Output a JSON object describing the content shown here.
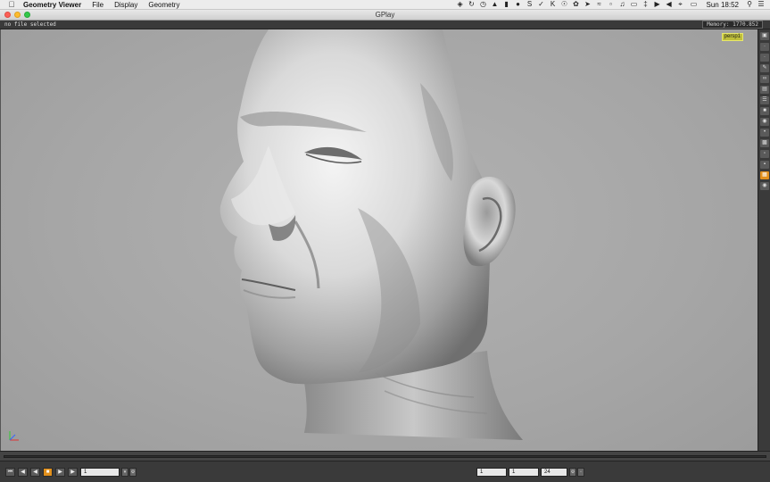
{
  "menubar": {
    "apple_icon": "apple-logo-icon",
    "items": [
      "Geometry Viewer",
      "File",
      "Display",
      "Geometry"
    ],
    "clock": "Sun 18:52",
    "tray_icons": [
      "dropbox-icon",
      "sync-icon",
      "clock-icon",
      "drive-icon",
      "bookmark-icon",
      "evernote-icon",
      "skype-icon",
      "bolt-icon",
      "kiwi-icon",
      "alarm-icon",
      "paw-icon",
      "rocket-icon",
      "wave-icon",
      "clip-icon",
      "note-icon",
      "airplay-icon",
      "bluetooth-icon",
      "play-icon",
      "volume-icon",
      "wifi-icon",
      "battery-icon",
      "search-icon",
      "list-icon"
    ]
  },
  "window": {
    "title": "GPlay"
  },
  "status": {
    "message": "no file selected",
    "memory": "Memory: 1770.852"
  },
  "viewport": {
    "camera": "persp1",
    "model": "3D scanned head mesh"
  },
  "toolbar": {
    "buttons": [
      "viewport-icon",
      "dot-icon",
      "dot-icon",
      "pen-icon",
      "link-icon",
      "display-icon",
      "layers-icon",
      "lock-icon",
      "sphere-icon",
      "brush-icon",
      "print-icon",
      "chat-icon",
      "save-icon",
      "grid-icon",
      "camera-icon"
    ]
  },
  "playback": {
    "buttons": [
      "first-frame-icon",
      "prev-key-icon",
      "step-back-icon",
      "stop-play-icon",
      "step-forward-icon",
      "last-frame-icon"
    ],
    "current_frame": "1",
    "range_start": "1",
    "range_end_a": "1",
    "range_end_b": "24"
  },
  "colors": {
    "accent": "#e2901c",
    "viewport_bg": "#a8a8a8",
    "camera_label": "#bfbf3a"
  }
}
